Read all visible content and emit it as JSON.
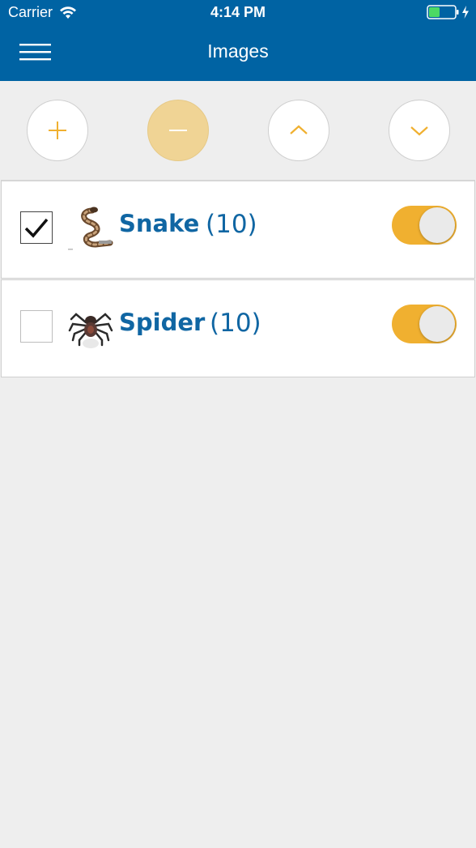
{
  "status_bar": {
    "carrier": "Carrier",
    "time": "4:14 PM",
    "battery_level_fraction": 0.4,
    "battery_color": "#4cd964"
  },
  "nav": {
    "title": "Images",
    "menu_icon": "hamburger-menu-icon"
  },
  "colors": {
    "header_bg": "#0063a3",
    "accent": "#f0b030",
    "label_blue": "#1066a3",
    "background": "#eeeeee"
  },
  "toolbar": {
    "buttons": [
      {
        "icon": "plus-icon",
        "active": false
      },
      {
        "icon": "minus-icon",
        "active": true
      },
      {
        "icon": "chevron-up-icon",
        "active": false
      },
      {
        "icon": "chevron-down-icon",
        "active": false
      }
    ]
  },
  "items": [
    {
      "label": "Snake",
      "count": "(10)",
      "checked": true,
      "enabled": true,
      "thumb_icon": "snake-icon"
    },
    {
      "label": "Spider",
      "count": "(10)",
      "checked": false,
      "enabled": true,
      "thumb_icon": "spider-icon"
    }
  ]
}
